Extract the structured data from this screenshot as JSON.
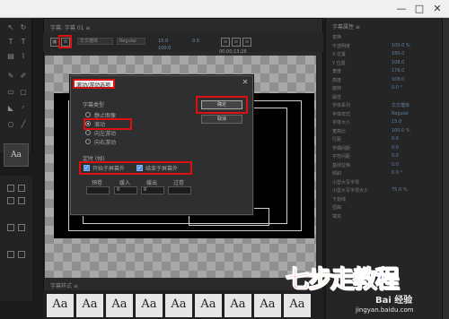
{
  "window": {
    "minimize": "—",
    "maximize": "□",
    "close": "✕"
  },
  "center_panel": {
    "tab_label": "字幕: 字幕 01 ≡",
    "timecode": "00;00;13;28",
    "font_size_values": [
      "15.0",
      "100.0",
      "0.0"
    ],
    "font_select": "华文楷体",
    "font_style": "Regular"
  },
  "styles": {
    "label": "字幕样式 ≡",
    "swatches": [
      "Aa",
      "Aa",
      "Aa",
      "Aa",
      "Aa",
      "Aa",
      "Aa",
      "Aa",
      "Aa",
      "Aa"
    ]
  },
  "properties": {
    "title": "字幕属性 ≡",
    "rows": [
      {
        "label": "变换",
        "value": ""
      },
      {
        "label": "不透明度",
        "value": "100.0 %"
      },
      {
        "label": "X 位置",
        "value": "180.0"
      },
      {
        "label": "Y 位置",
        "value": "108.0"
      },
      {
        "label": "宽度",
        "value": "176.0"
      },
      {
        "label": "高度",
        "value": "108.0"
      },
      {
        "label": "旋转",
        "value": "0.0 °"
      },
      {
        "label": "属性",
        "value": ""
      },
      {
        "label": "字体系列",
        "value": "华文楷体"
      },
      {
        "label": "字体样式",
        "value": "Regular"
      },
      {
        "label": "字体大小",
        "value": "15.0"
      },
      {
        "label": "宽高比",
        "value": "100.0 %"
      },
      {
        "label": "行距",
        "value": "0.0"
      },
      {
        "label": "字偶间距",
        "value": "0.0"
      },
      {
        "label": "字符间距",
        "value": "0.0"
      },
      {
        "label": "基线位移",
        "value": "0.0"
      },
      {
        "label": "倾斜",
        "value": "0.0 °"
      },
      {
        "label": "小型大写字母",
        "value": ""
      },
      {
        "label": "小型大写字母大小",
        "value": "75.0 %"
      },
      {
        "label": "下划线",
        "value": ""
      },
      {
        "label": "扭曲",
        "value": ""
      },
      {
        "label": "填充",
        "value": ""
      }
    ]
  },
  "dialog": {
    "title": "滚动/游动选项",
    "close": "✕",
    "section_type": "字幕类型",
    "radio_options": [
      "静止图像",
      "滚动",
      "向左游动",
      "向右游动"
    ],
    "selected_index": 1,
    "ok_label": "确定",
    "cancel_label": "取消",
    "section_timing": "定时 (帧)",
    "check_start": "开始于屏幕外",
    "check_end": "结束于屏幕外",
    "timing_labels": [
      "预卷",
      "缓入",
      "缓出",
      "过卷"
    ],
    "timing_values": [
      "",
      "0",
      "0",
      ""
    ]
  },
  "watermark": {
    "logo_text": "七步走教程",
    "logo_colors": [
      "#e8233a",
      "#f29c1f",
      "#e8233a",
      "#2f6fd8",
      "#7b3fc8"
    ],
    "baidu": "Bai 经验",
    "url": "jingyan.baidu.com"
  }
}
